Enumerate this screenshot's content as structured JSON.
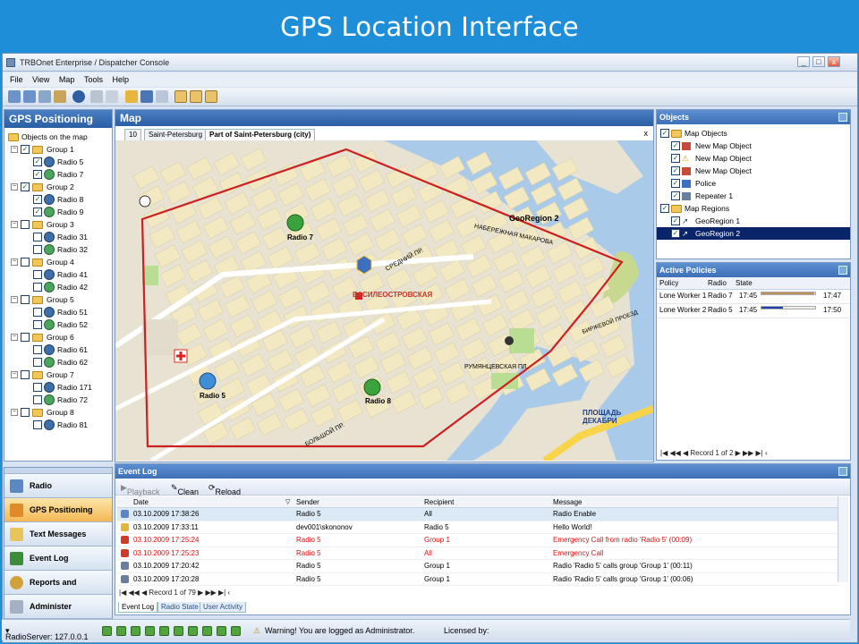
{
  "banner": {
    "title": "GPS Location Interface"
  },
  "window": {
    "title": "TRBOnet Enterprise / Dispatcher Console",
    "min": "_",
    "max": "□",
    "close": "x"
  },
  "menu": [
    "File",
    "View",
    "Map",
    "Tools",
    "Help"
  ],
  "gps": {
    "title": "GPS Positioning",
    "root": "Objects on the map",
    "groups": [
      {
        "name": "Group 1",
        "radios": [
          "Radio 5",
          "Radio 7"
        ]
      },
      {
        "name": "Group 2",
        "radios": [
          "Radio 8",
          "Radio 9"
        ]
      },
      {
        "name": "Group 3",
        "radios": [
          "Radio 31",
          "Radio 32"
        ]
      },
      {
        "name": "Group 4",
        "radios": [
          "Radio 41",
          "Radio 42"
        ]
      },
      {
        "name": "Group 5",
        "radios": [
          "Radio 51",
          "Radio 52"
        ]
      },
      {
        "name": "Group 6",
        "radios": [
          "Radio 61",
          "Radio 62"
        ]
      },
      {
        "name": "Group 7",
        "radios": [
          "Radio 171",
          "Radio 72"
        ]
      },
      {
        "name": "Group 8",
        "radios": [
          "Radio 81"
        ]
      }
    ]
  },
  "nav": [
    "Radio",
    "GPS Positioning",
    "Text Messages",
    "Event Log",
    "Reports and Statistics",
    "Administer"
  ],
  "map": {
    "title": "Map",
    "tabs": [
      "10",
      "Saint-Petersburg",
      "Part of Saint-Petersburg (city)"
    ],
    "close": "x",
    "labels": {
      "geo": "GeoRegion 2",
      "metro": "ВАСИЛЕОСТРОВСКАЯ",
      "r7": "Radio 7",
      "r5": "Radio 5",
      "r8": "Radio 8",
      "sq": "ПЛОЩАДЬ ДЕКАБРИ",
      "emb": "НАБЕРЕЖНАЯ МАКАРОВА",
      "prosp": "СРЕДНИЙ ПР.",
      "pr2": "БОЛЬШОЙ ПР.",
      "rum": "РУМЯНЦЕВСКАЯ ПЛ.",
      "birj": "БИРЖЕВОЙ ПРОЕЗД"
    }
  },
  "objects": {
    "title": "Objects",
    "items": [
      "Map Objects",
      "New Map Object",
      "New Map Object",
      "New Map Object",
      "Police",
      "Repeater 1",
      "Map Regions",
      "GeoRegion 1",
      "GeoRegion 2"
    ]
  },
  "policies": {
    "title": "Active Policies",
    "headers": [
      "Policy",
      "Radio",
      "State"
    ],
    "rows": [
      {
        "policy": "Lone Worker 1",
        "radio": "Radio 7",
        "start": "17:45",
        "end": "17:47",
        "progress": 0.98
      },
      {
        "policy": "Lone Worker 2",
        "radio": "Radio 5",
        "start": "17:45",
        "end": "17:50",
        "progress": 0.4
      }
    ],
    "pager": "Record 1 of 2"
  },
  "log": {
    "title": "Event Log",
    "playback": "Playback",
    "clean": "Clean",
    "reload": "Reload",
    "headers": [
      "Date",
      "Sender",
      "Recipient",
      "Message"
    ],
    "rows": [
      {
        "date": "03.10.2009 17:38:26",
        "sender": "Radio 5",
        "recipient": "All",
        "message": "Radio Enable",
        "sel": true,
        "red": false
      },
      {
        "date": "03.10.2009 17:33:11",
        "sender": "dev001\\skononov",
        "recipient": "Radio 5",
        "message": "Hello World!",
        "sel": false,
        "red": false
      },
      {
        "date": "03.10.2009 17:25:24",
        "sender": "Radio 5",
        "recipient": "Group 1",
        "message": "Emergency Call from radio 'Radio 5' (00:09)",
        "sel": false,
        "red": true
      },
      {
        "date": "03.10.2009 17:25:23",
        "sender": "Radio 5",
        "recipient": "All",
        "message": "Emergency Call",
        "sel": false,
        "red": true
      },
      {
        "date": "03.10.2009 17:20:42",
        "sender": "Radio 5",
        "recipient": "Group 1",
        "message": "Radio 'Radio 5' calls group 'Group 1' (00:11)",
        "sel": false,
        "red": false
      },
      {
        "date": "03.10.2009 17:20:28",
        "sender": "Radio 5",
        "recipient": "Group 1",
        "message": "Radio 'Radio 5' calls group 'Group 1' (00:06)",
        "sel": false,
        "red": false
      }
    ],
    "pager": "Record 1 of 79",
    "tabs": [
      "Event Log",
      "Radio State",
      "User Activity"
    ]
  },
  "status": {
    "server": "RadioServer: 127.0.0.1",
    "warning": "Warning! You are logged as Administrator.",
    "licensed": "Licensed by:"
  },
  "colors": {
    "accent": "#1d8ed7",
    "region": "#cc1f1f",
    "water": "#a9cbe9",
    "block": "#f2e9c3",
    "park": "#b9dd93"
  }
}
